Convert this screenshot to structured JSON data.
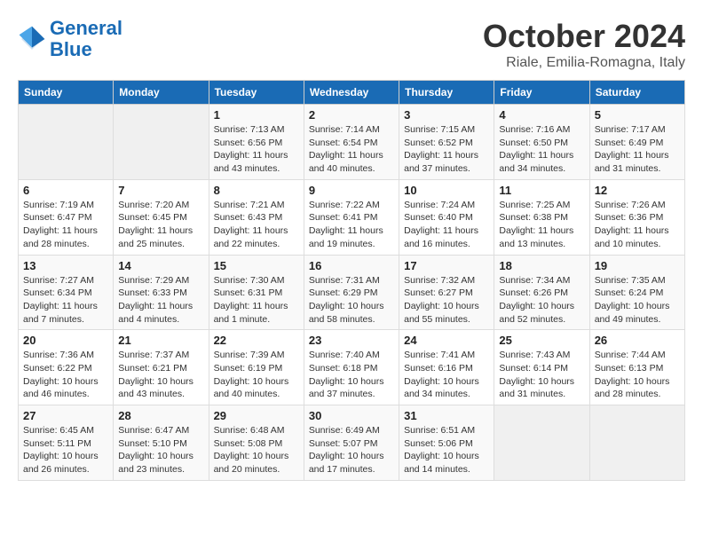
{
  "header": {
    "logo_line1": "General",
    "logo_line2": "Blue",
    "month": "October 2024",
    "location": "Riale, Emilia-Romagna, Italy"
  },
  "weekdays": [
    "Sunday",
    "Monday",
    "Tuesday",
    "Wednesday",
    "Thursday",
    "Friday",
    "Saturday"
  ],
  "weeks": [
    [
      {
        "day": "",
        "sunrise": "",
        "sunset": "",
        "daylight": "",
        "empty": true
      },
      {
        "day": "",
        "sunrise": "",
        "sunset": "",
        "daylight": "",
        "empty": true
      },
      {
        "day": "1",
        "sunrise": "Sunrise: 7:13 AM",
        "sunset": "Sunset: 6:56 PM",
        "daylight": "Daylight: 11 hours and 43 minutes."
      },
      {
        "day": "2",
        "sunrise": "Sunrise: 7:14 AM",
        "sunset": "Sunset: 6:54 PM",
        "daylight": "Daylight: 11 hours and 40 minutes."
      },
      {
        "day": "3",
        "sunrise": "Sunrise: 7:15 AM",
        "sunset": "Sunset: 6:52 PM",
        "daylight": "Daylight: 11 hours and 37 minutes."
      },
      {
        "day": "4",
        "sunrise": "Sunrise: 7:16 AM",
        "sunset": "Sunset: 6:50 PM",
        "daylight": "Daylight: 11 hours and 34 minutes."
      },
      {
        "day": "5",
        "sunrise": "Sunrise: 7:17 AM",
        "sunset": "Sunset: 6:49 PM",
        "daylight": "Daylight: 11 hours and 31 minutes."
      }
    ],
    [
      {
        "day": "6",
        "sunrise": "Sunrise: 7:19 AM",
        "sunset": "Sunset: 6:47 PM",
        "daylight": "Daylight: 11 hours and 28 minutes."
      },
      {
        "day": "7",
        "sunrise": "Sunrise: 7:20 AM",
        "sunset": "Sunset: 6:45 PM",
        "daylight": "Daylight: 11 hours and 25 minutes."
      },
      {
        "day": "8",
        "sunrise": "Sunrise: 7:21 AM",
        "sunset": "Sunset: 6:43 PM",
        "daylight": "Daylight: 11 hours and 22 minutes."
      },
      {
        "day": "9",
        "sunrise": "Sunrise: 7:22 AM",
        "sunset": "Sunset: 6:41 PM",
        "daylight": "Daylight: 11 hours and 19 minutes."
      },
      {
        "day": "10",
        "sunrise": "Sunrise: 7:24 AM",
        "sunset": "Sunset: 6:40 PM",
        "daylight": "Daylight: 11 hours and 16 minutes."
      },
      {
        "day": "11",
        "sunrise": "Sunrise: 7:25 AM",
        "sunset": "Sunset: 6:38 PM",
        "daylight": "Daylight: 11 hours and 13 minutes."
      },
      {
        "day": "12",
        "sunrise": "Sunrise: 7:26 AM",
        "sunset": "Sunset: 6:36 PM",
        "daylight": "Daylight: 11 hours and 10 minutes."
      }
    ],
    [
      {
        "day": "13",
        "sunrise": "Sunrise: 7:27 AM",
        "sunset": "Sunset: 6:34 PM",
        "daylight": "Daylight: 11 hours and 7 minutes."
      },
      {
        "day": "14",
        "sunrise": "Sunrise: 7:29 AM",
        "sunset": "Sunset: 6:33 PM",
        "daylight": "Daylight: 11 hours and 4 minutes."
      },
      {
        "day": "15",
        "sunrise": "Sunrise: 7:30 AM",
        "sunset": "Sunset: 6:31 PM",
        "daylight": "Daylight: 11 hours and 1 minute."
      },
      {
        "day": "16",
        "sunrise": "Sunrise: 7:31 AM",
        "sunset": "Sunset: 6:29 PM",
        "daylight": "Daylight: 10 hours and 58 minutes."
      },
      {
        "day": "17",
        "sunrise": "Sunrise: 7:32 AM",
        "sunset": "Sunset: 6:27 PM",
        "daylight": "Daylight: 10 hours and 55 minutes."
      },
      {
        "day": "18",
        "sunrise": "Sunrise: 7:34 AM",
        "sunset": "Sunset: 6:26 PM",
        "daylight": "Daylight: 10 hours and 52 minutes."
      },
      {
        "day": "19",
        "sunrise": "Sunrise: 7:35 AM",
        "sunset": "Sunset: 6:24 PM",
        "daylight": "Daylight: 10 hours and 49 minutes."
      }
    ],
    [
      {
        "day": "20",
        "sunrise": "Sunrise: 7:36 AM",
        "sunset": "Sunset: 6:22 PM",
        "daylight": "Daylight: 10 hours and 46 minutes."
      },
      {
        "day": "21",
        "sunrise": "Sunrise: 7:37 AM",
        "sunset": "Sunset: 6:21 PM",
        "daylight": "Daylight: 10 hours and 43 minutes."
      },
      {
        "day": "22",
        "sunrise": "Sunrise: 7:39 AM",
        "sunset": "Sunset: 6:19 PM",
        "daylight": "Daylight: 10 hours and 40 minutes."
      },
      {
        "day": "23",
        "sunrise": "Sunrise: 7:40 AM",
        "sunset": "Sunset: 6:18 PM",
        "daylight": "Daylight: 10 hours and 37 minutes."
      },
      {
        "day": "24",
        "sunrise": "Sunrise: 7:41 AM",
        "sunset": "Sunset: 6:16 PM",
        "daylight": "Daylight: 10 hours and 34 minutes."
      },
      {
        "day": "25",
        "sunrise": "Sunrise: 7:43 AM",
        "sunset": "Sunset: 6:14 PM",
        "daylight": "Daylight: 10 hours and 31 minutes."
      },
      {
        "day": "26",
        "sunrise": "Sunrise: 7:44 AM",
        "sunset": "Sunset: 6:13 PM",
        "daylight": "Daylight: 10 hours and 28 minutes."
      }
    ],
    [
      {
        "day": "27",
        "sunrise": "Sunrise: 6:45 AM",
        "sunset": "Sunset: 5:11 PM",
        "daylight": "Daylight: 10 hours and 26 minutes."
      },
      {
        "day": "28",
        "sunrise": "Sunrise: 6:47 AM",
        "sunset": "Sunset: 5:10 PM",
        "daylight": "Daylight: 10 hours and 23 minutes."
      },
      {
        "day": "29",
        "sunrise": "Sunrise: 6:48 AM",
        "sunset": "Sunset: 5:08 PM",
        "daylight": "Daylight: 10 hours and 20 minutes."
      },
      {
        "day": "30",
        "sunrise": "Sunrise: 6:49 AM",
        "sunset": "Sunset: 5:07 PM",
        "daylight": "Daylight: 10 hours and 17 minutes."
      },
      {
        "day": "31",
        "sunrise": "Sunrise: 6:51 AM",
        "sunset": "Sunset: 5:06 PM",
        "daylight": "Daylight: 10 hours and 14 minutes."
      },
      {
        "day": "",
        "sunrise": "",
        "sunset": "",
        "daylight": "",
        "empty": true
      },
      {
        "day": "",
        "sunrise": "",
        "sunset": "",
        "daylight": "",
        "empty": true
      }
    ]
  ]
}
